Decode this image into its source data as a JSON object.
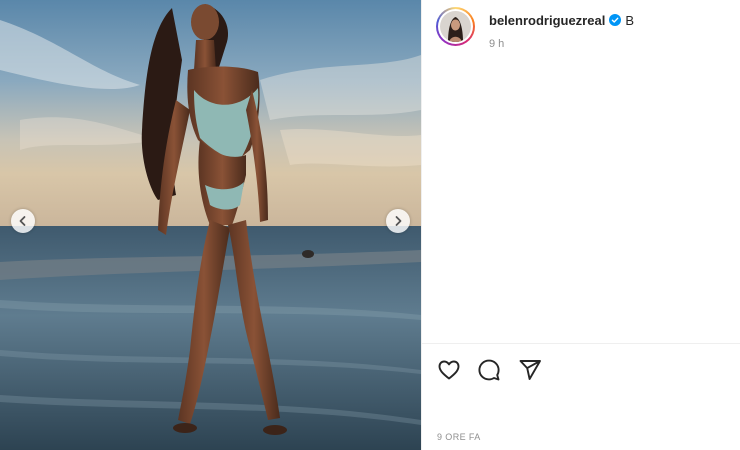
{
  "post": {
    "username": "belenrodriguezreal",
    "caption": "B",
    "time_ago": "9 h",
    "date_label": "9 ORE FA"
  },
  "icons": {
    "verified": "verified-badge-icon",
    "like": "heart-icon",
    "comment": "comment-icon",
    "share": "send-icon",
    "prev": "chevron-left-icon",
    "next": "chevron-right-icon"
  },
  "colors": {
    "verified_blue": "#0095f6",
    "text_primary": "#262626",
    "text_secondary": "#8e8e8e"
  }
}
